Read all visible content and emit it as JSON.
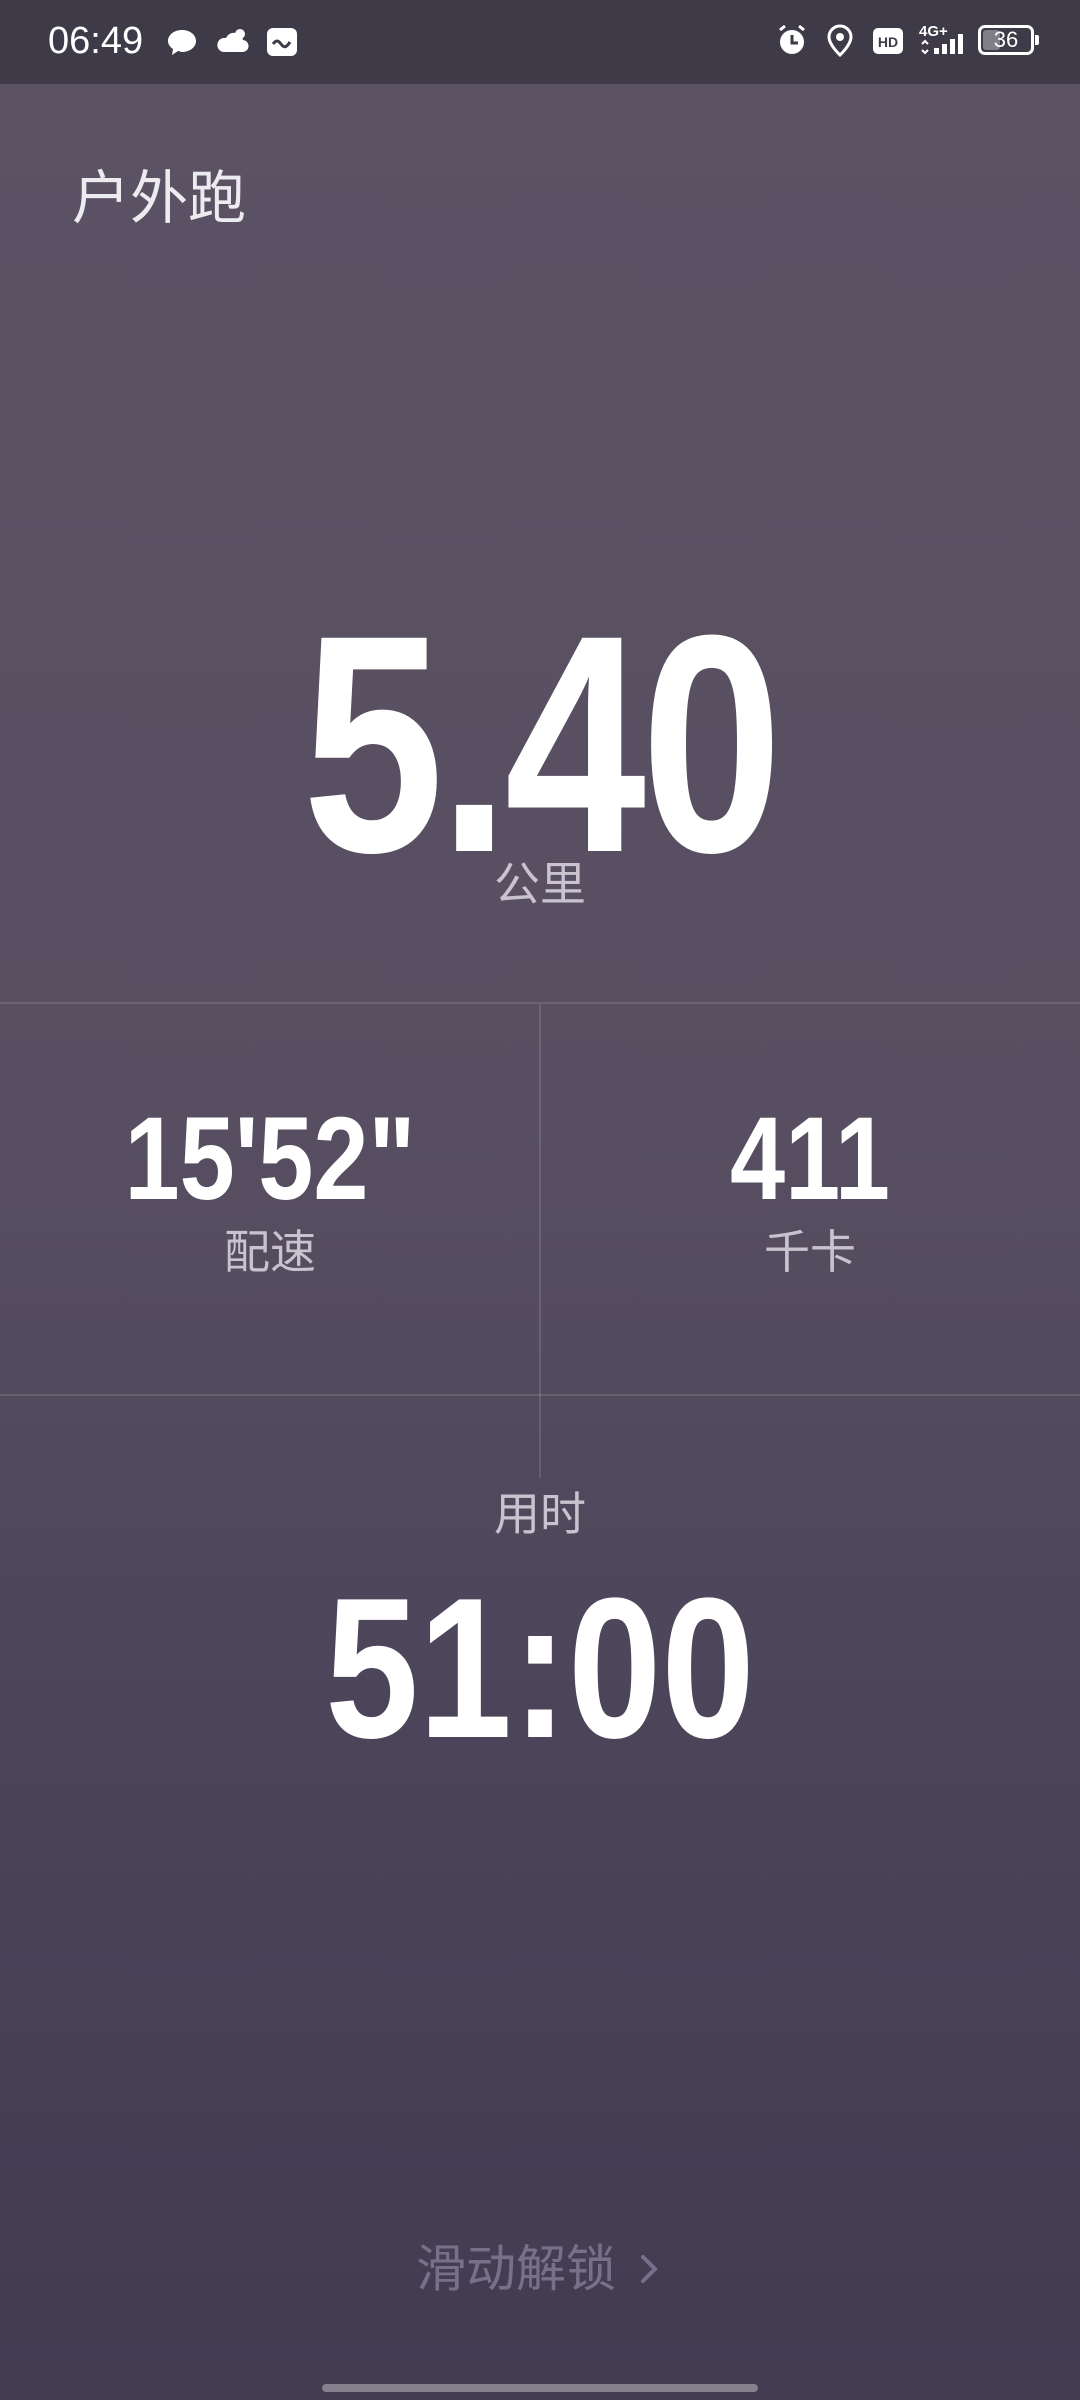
{
  "status_bar": {
    "time": "06:49",
    "left_icons": [
      "chat-bubble-icon",
      "cloud-icon",
      "app-notification-icon"
    ],
    "right_icons": [
      "alarm-icon",
      "location-pin-icon",
      "hd-icon",
      "signal-4g-icon"
    ],
    "network": "4G+",
    "battery_level": "36",
    "battery_fraction": 0.36
  },
  "workout": {
    "title": "户外跑",
    "distance_value": "5.40",
    "distance_unit": "公里",
    "pace_value": "15'52\"",
    "pace_label": "配速",
    "calories_value": "411",
    "calories_label": "千卡",
    "duration_label": "用时",
    "duration_value": "51:00"
  },
  "unlock": {
    "label": "滑动解锁"
  },
  "colors": {
    "background": "#5a5263",
    "status_bar": "#3f3a48",
    "primary_text": "#ffffff",
    "secondary_text": "#c9c3cf",
    "hint_text": "#78708a"
  }
}
